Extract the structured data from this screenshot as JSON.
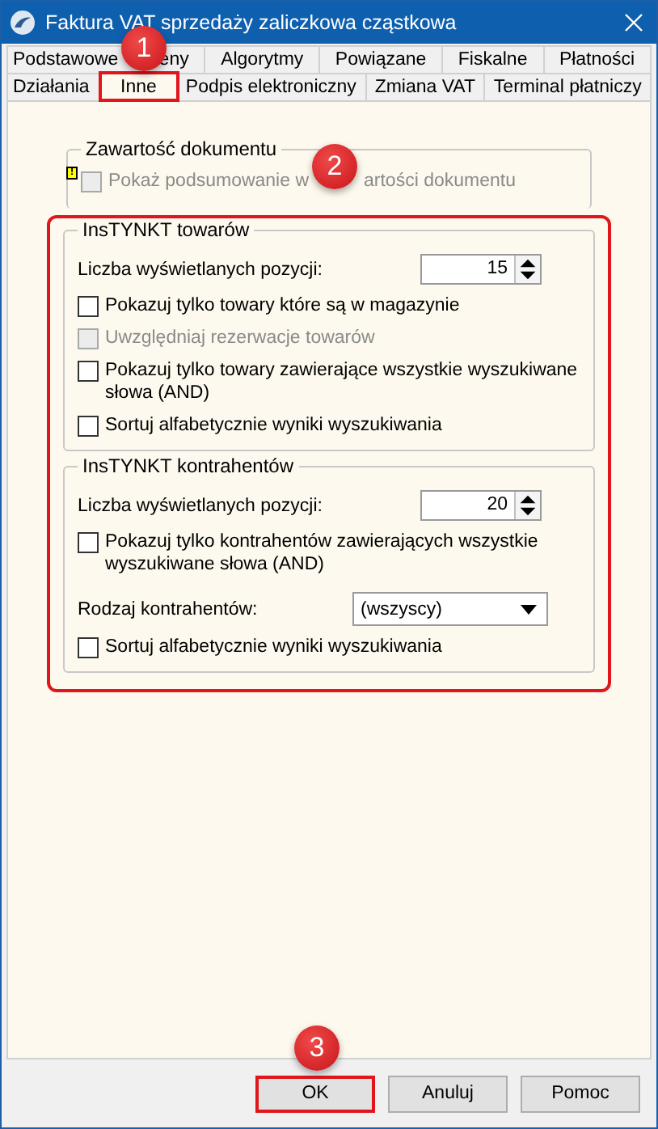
{
  "window": {
    "title": "Faktura VAT sprzedaży zaliczkowa cząstkowa"
  },
  "tabs": [
    [
      {
        "label": "Podstawowe",
        "selected": false,
        "highlighted": false
      },
      {
        "label": "eny",
        "selected": false,
        "highlighted": false
      },
      {
        "label": "Algorytmy",
        "selected": false,
        "highlighted": false
      },
      {
        "label": "Powiązane",
        "selected": false,
        "highlighted": false
      },
      {
        "label": "Fiskalne",
        "selected": false,
        "highlighted": false
      },
      {
        "label": "Płatności",
        "selected": false,
        "highlighted": false
      }
    ],
    [
      {
        "label": "Działania",
        "selected": false,
        "highlighted": false
      },
      {
        "label": "Inne",
        "selected": true,
        "highlighted": true
      },
      {
        "label": "Podpis elektroniczny",
        "selected": false,
        "highlighted": false
      },
      {
        "label": "Zmiana VAT",
        "selected": false,
        "highlighted": false
      },
      {
        "label": "Terminal płatniczy",
        "selected": false,
        "highlighted": false
      }
    ]
  ],
  "document_group": {
    "legend": "Zawartość dokumentu",
    "warning": "!",
    "checkbox": {
      "label_parts": [
        "Pokaż podsumowanie w",
        "artości dokumentu"
      ],
      "checked": false,
      "disabled": true
    }
  },
  "options_section": {
    "highlighted": true,
    "groups": [
      {
        "legend": "InsTYNKT towarów",
        "items": [
          {
            "kind": "spinner",
            "label": "Liczba wyświetlanych pozycji:",
            "value": "15"
          },
          {
            "kind": "checkbox",
            "label": "Pokazuj tylko towary które są w magazynie",
            "checked": false,
            "disabled": false
          },
          {
            "kind": "checkbox",
            "label": "Uwzględniaj rezerwacje towarów",
            "checked": false,
            "disabled": true
          },
          {
            "kind": "checkbox",
            "label": "Pokazuj tylko towary zawierające wszystkie wyszukiwane słowa (AND)",
            "checked": false,
            "disabled": false
          },
          {
            "kind": "checkbox",
            "label": "Sortuj alfabetycznie wyniki wyszukiwania",
            "checked": false,
            "disabled": false
          }
        ]
      },
      {
        "legend": "InsTYNKT kontrahentów",
        "items": [
          {
            "kind": "spinner",
            "label": "Liczba wyświetlanych pozycji:",
            "value": "20"
          },
          {
            "kind": "checkbox",
            "label": "Pokazuj tylko kontrahentów zawierających wszystkie wyszukiwane słowa (AND)",
            "checked": false,
            "disabled": false
          },
          {
            "kind": "select",
            "label": "Rodzaj kontrahentów:",
            "value": "(wszyscy)"
          },
          {
            "kind": "checkbox",
            "label": "Sortuj alfabetycznie wyniki wyszukiwania",
            "checked": false,
            "disabled": false
          }
        ]
      }
    ]
  },
  "buttons": [
    {
      "label": "OK",
      "highlighted": true
    },
    {
      "label": "Anuluj",
      "highlighted": false
    },
    {
      "label": "Pomoc",
      "highlighted": false
    }
  ],
  "badges": [
    {
      "text": "1"
    },
    {
      "text": "2"
    },
    {
      "text": "3"
    }
  ]
}
